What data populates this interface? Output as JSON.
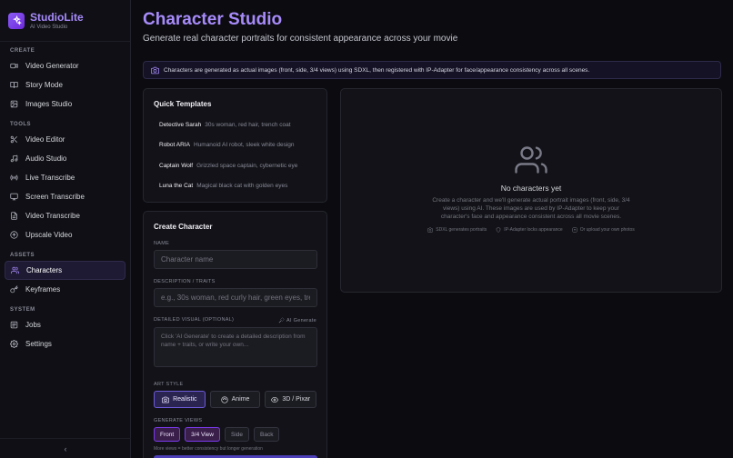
{
  "brand": {
    "name": "StudioLite",
    "subtitle": "AI Video Studio"
  },
  "sidebar": {
    "sections": {
      "create": "CREATE",
      "tools": "TOOLS",
      "assets": "ASSETS",
      "system": "SYSTEM"
    },
    "create_items": [
      {
        "label": "Video Generator",
        "icon": "video-icon"
      },
      {
        "label": "Story Mode",
        "icon": "book-icon"
      },
      {
        "label": "Images Studio",
        "icon": "image-icon"
      }
    ],
    "tool_items": [
      {
        "label": "Video Editor",
        "icon": "scissors-icon"
      },
      {
        "label": "Audio Studio",
        "icon": "music-icon"
      },
      {
        "label": "Live Transcribe",
        "icon": "radio-icon"
      },
      {
        "label": "Screen Transcribe",
        "icon": "monitor-icon"
      },
      {
        "label": "Video Transcribe",
        "icon": "file-text-icon"
      },
      {
        "label": "Upscale Video",
        "icon": "upscale-icon"
      }
    ],
    "asset_items": [
      {
        "label": "Characters",
        "icon": "users-icon",
        "active": true
      },
      {
        "label": "Keyframes",
        "icon": "key-icon"
      }
    ],
    "system_items": [
      {
        "label": "Jobs",
        "icon": "list-icon"
      },
      {
        "label": "Settings",
        "icon": "gear-icon"
      }
    ],
    "collapse_glyph": "‹"
  },
  "header": {
    "title": "Character Studio",
    "subtitle": "Generate real character portraits for consistent appearance across your movie"
  },
  "info_bar": {
    "text": "Characters are generated as actual images (front, side, 3/4 views) using SDXL, then registered with IP-Adapter for face/appearance consistency across all scenes."
  },
  "templates": {
    "title": "Quick Templates",
    "items": [
      {
        "name": "Detective Sarah",
        "desc": "30s woman, red hair, trench coat"
      },
      {
        "name": "Robot ARIA",
        "desc": "Humanoid AI robot, sleek white design"
      },
      {
        "name": "Captain Wolf",
        "desc": "Grizzled space captain, cybernetic eye"
      },
      {
        "name": "Luna the Cat",
        "desc": "Magical black cat with golden eyes"
      }
    ]
  },
  "create": {
    "title": "Create Character",
    "name_label": "NAME",
    "name_placeholder": "Character name",
    "traits_label": "DESCRIPTION / TRAITS",
    "traits_placeholder": "e.g., 30s woman, red curly hair, green eyes, trench coat",
    "visual_label": "DETAILED VISUAL (OPTIONAL)",
    "ai_generate": "AI Generate",
    "visual_placeholder": "Click 'AI Generate' to create a detailed description from name + traits, or write your own...",
    "art_style_label": "ART STYLE",
    "art_styles": [
      {
        "label": "Realistic",
        "icon": "camera-icon",
        "selected": true
      },
      {
        "label": "Anime",
        "icon": "palette-icon",
        "selected": false
      },
      {
        "label": "3D / Pixar",
        "icon": "eye-icon",
        "selected": false
      }
    ],
    "views_label": "GENERATE VIEWS",
    "views": [
      {
        "label": "Front",
        "selected": true
      },
      {
        "label": "3/4 View",
        "selected": true
      },
      {
        "label": "Side",
        "selected": false
      },
      {
        "label": "Back",
        "selected": false
      }
    ],
    "views_hint": "More views = better consistency but longer generation"
  },
  "empty_state": {
    "title": "No characters yet",
    "description": "Create a character and we'll generate actual portrait images (front, side, 3/4 views) using AI. These images are used by IP-Adapter to keep your character's face and appearance consistent across all movie scenes.",
    "features": [
      {
        "label": "SDXL generates portraits",
        "icon": "camera-icon"
      },
      {
        "label": "IP-Adapter locks appearance",
        "icon": "shield-icon"
      },
      {
        "label": "Or upload your own photos",
        "icon": "upload-icon"
      }
    ]
  }
}
